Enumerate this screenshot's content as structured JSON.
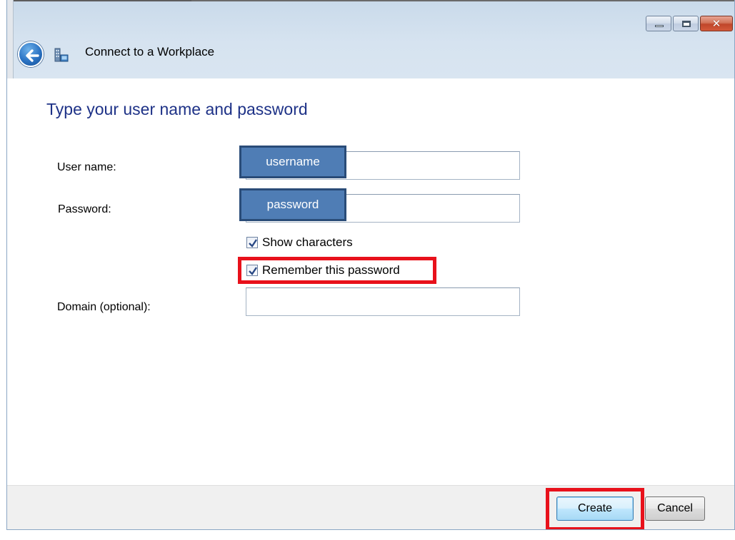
{
  "window": {
    "title": "Connect to a Workplace",
    "icons": {
      "back": "back-arrow-icon",
      "app": "workplace-network-icon",
      "minimize": "minimize-icon",
      "maximize": "maximize-icon",
      "close": "close-icon"
    }
  },
  "form": {
    "heading": "Type your user name and password",
    "username": {
      "label": "User name:",
      "value": "",
      "overlay": "username"
    },
    "password": {
      "label": "Password:",
      "value": "",
      "overlay": "password"
    },
    "show_characters": {
      "label": "Show characters",
      "checked": true
    },
    "remember_password": {
      "label": "Remember this password",
      "checked": true
    },
    "domain": {
      "label": "Domain (optional):",
      "value": ""
    }
  },
  "buttons": {
    "create": "Create",
    "cancel": "Cancel"
  },
  "colors": {
    "heading": "#1e3287",
    "highlight": "#e8111b",
    "chip_fill": "#4f7db5",
    "chip_border": "#2a4c78"
  }
}
